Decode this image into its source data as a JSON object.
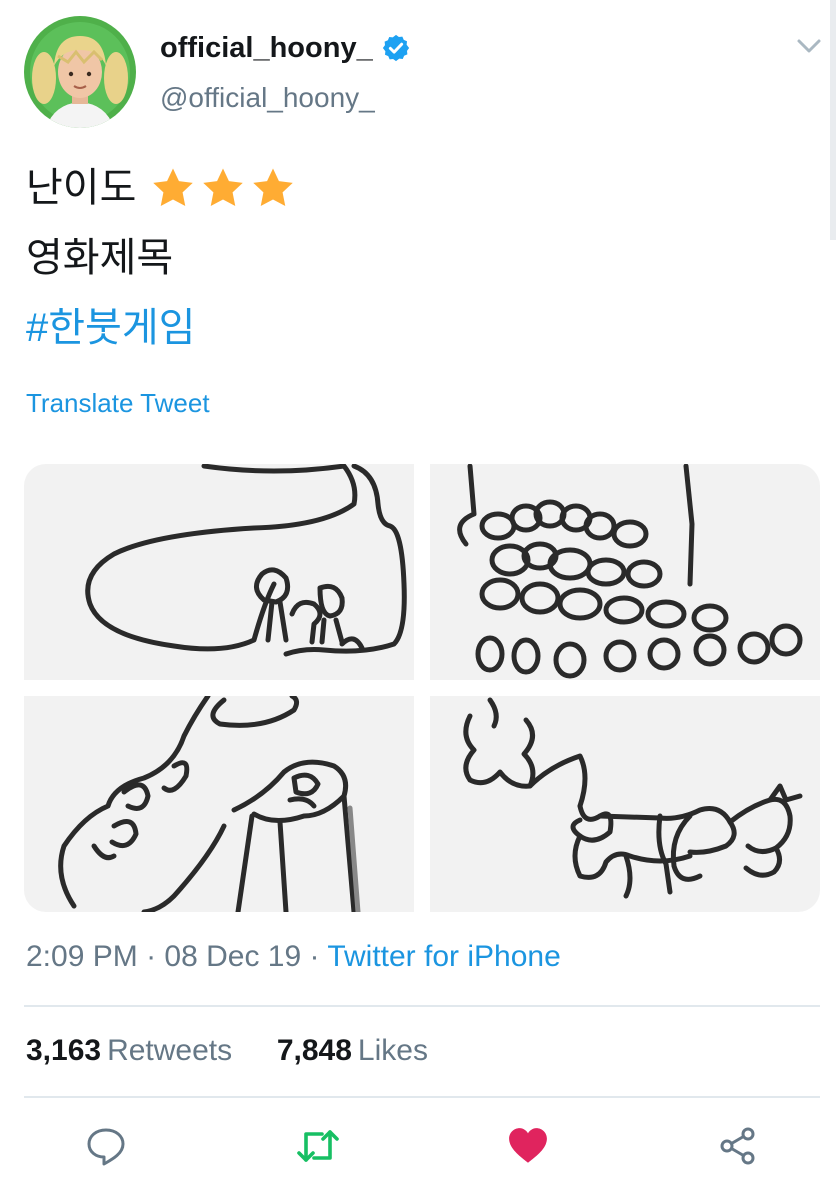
{
  "user": {
    "display_name": "official_hoony_",
    "handle": "@official_hoony_",
    "verified": true,
    "avatar_icon": "avatar-photo"
  },
  "tweet": {
    "line1_text": "난이도",
    "stars": 3,
    "star_color": "#ffac33",
    "line2_text": "영화제목",
    "hashtag": "#한붓게임"
  },
  "translate_link": "Translate Tweet",
  "meta": {
    "time": "2:09 PM",
    "separator": "·",
    "date": "08 Dec 19",
    "source": "Twitter for iPhone"
  },
  "stats": {
    "retweets_count": "3,163",
    "retweets_label": "Retweets",
    "likes_count": "7,848",
    "likes_label": "Likes"
  },
  "actions": {
    "reply_icon": "reply-icon",
    "retweet_icon": "retweet-icon",
    "like_icon": "heart-icon",
    "share_icon": "share-icon",
    "retweet_color": "#17bf63",
    "like_color": "#e0245e"
  },
  "colors": {
    "link_blue": "#1b95e0",
    "muted_gray": "#657786",
    "text_dark": "#14171a"
  }
}
